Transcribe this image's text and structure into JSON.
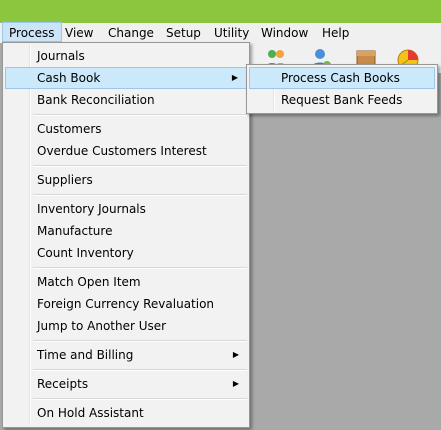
{
  "menubar": {
    "items": [
      "Process",
      "View",
      "Change",
      "Setup",
      "Utility",
      "Window",
      "Help"
    ]
  },
  "toolbar": {
    "icons": [
      "users-icon",
      "user-icon",
      "box-icon",
      "pie-chart-icon"
    ]
  },
  "process_menu": {
    "journals": "Journals",
    "cash_book": "Cash Book",
    "bank_reconciliation": "Bank Reconciliation",
    "customers": "Customers",
    "overdue_customers_interest": "Overdue Customers Interest",
    "suppliers": "Suppliers",
    "inventory_journals": "Inventory Journals",
    "manufacture": "Manufacture",
    "count_inventory": "Count Inventory",
    "match_open_item": "Match Open Item",
    "foreign_currency_revaluation": "Foreign Currency Revaluation",
    "jump_to_another_user": "Jump to Another User",
    "time_and_billing": "Time and Billing",
    "receipts": "Receipts",
    "on_hold_assistant": "On Hold Assistant"
  },
  "cash_book_submenu": {
    "process_cash_books": "Process Cash Books",
    "request_bank_feeds": "Request Bank Feeds"
  },
  "colors": {
    "title_bar": "#8cc63f",
    "workspace": "#a9a9a9",
    "highlight": "#cce8fb"
  }
}
